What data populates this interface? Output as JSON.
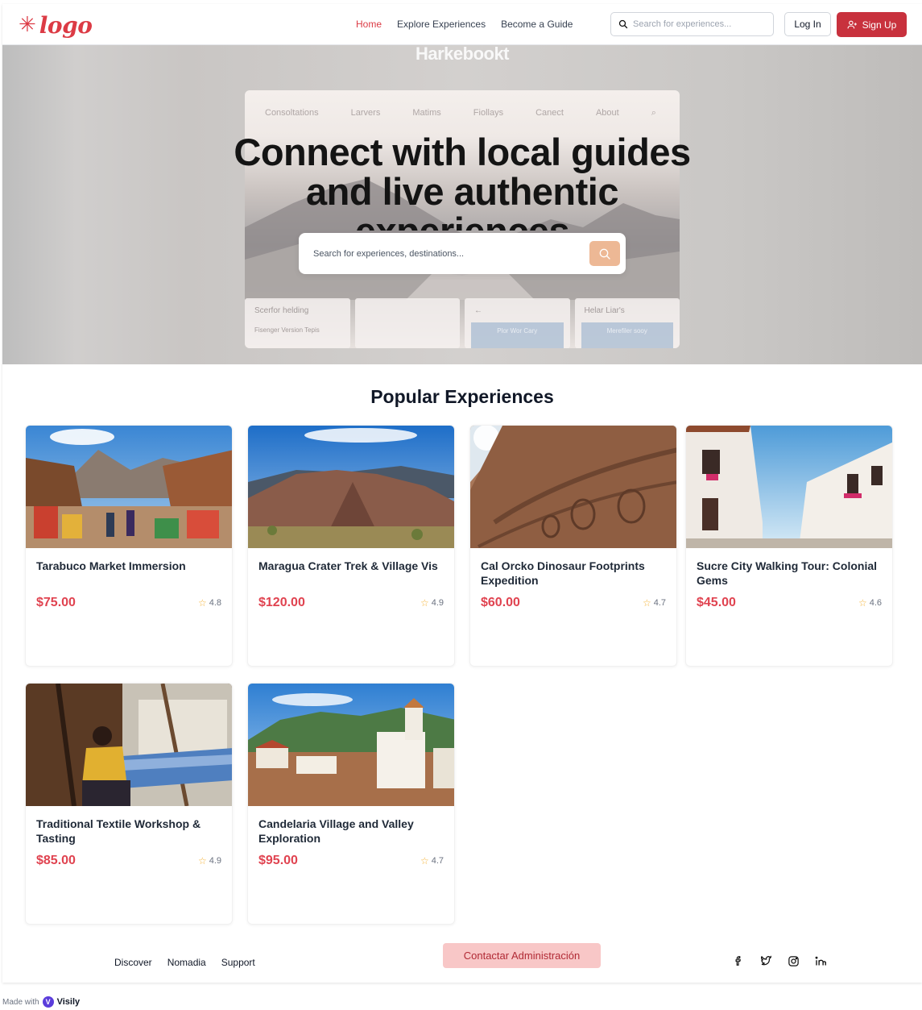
{
  "header": {
    "logo_text": "logo",
    "nav": [
      {
        "label": "Home",
        "active": true
      },
      {
        "label": "Explore Experiences",
        "active": false
      },
      {
        "label": "Become a Guide",
        "active": false
      }
    ],
    "search_placeholder": "Search for experiences...",
    "login_label": "Log In",
    "signup_label": "Sign Up"
  },
  "hero": {
    "ghost_title": "Harkebookt",
    "ghost_nav": [
      "Consoltations",
      "Larvers",
      "Matims",
      "Fiollays",
      "Canect",
      "About"
    ],
    "ghost_tiles": [
      {
        "title": "Scerfor helding",
        "sub": "Fisenger Version Tepis"
      },
      {
        "title": "",
        "sub": ""
      },
      {
        "title": "←",
        "sub": "Plor Wor Cary"
      },
      {
        "title": "Helar Liar's",
        "sub": "Merefiler sooy"
      }
    ],
    "headline_line1": "Connect with local guides",
    "headline_line2": "and live authentic",
    "headline_line3": "experiences",
    "search_placeholder": "Search for experiences, destinations..."
  },
  "section": {
    "title": "Popular Experiences"
  },
  "experiences": [
    {
      "title": "Tarabuco Market Immersion",
      "price": "$75.00",
      "rating": "4.8"
    },
    {
      "title": "Maragua Crater Trek & Village Vis",
      "price": "$120.00",
      "rating": "4.9"
    },
    {
      "title": "Cal Orcko Dinosaur Footprints Expedition",
      "price": "$60.00",
      "rating": "4.7"
    },
    {
      "title": "Sucre City Walking Tour: Colonial Gems",
      "price": "$45.00",
      "rating": "4.6"
    },
    {
      "title": "Traditional Textile Workshop & Tasting",
      "price": "$85.00",
      "rating": "4.9"
    },
    {
      "title": "Candelaria Village and Valley Exploration",
      "price": "$95.00",
      "rating": "4.7"
    }
  ],
  "footer": {
    "links": [
      "Discover",
      "Nomadia",
      "Support"
    ],
    "admin_label": "Contactar Administración",
    "socials": [
      "facebook-icon",
      "twitter-icon",
      "instagram-icon",
      "linkedin-icon"
    ]
  },
  "made_with": {
    "prefix": "Made with",
    "brand": "Visily"
  },
  "colors": {
    "accent": "#dc3b45",
    "signup": "#c8313d",
    "price": "#e04350",
    "star": "#f5b43b",
    "admin_bg": "#f8c7c7",
    "search_btn": "#edb895"
  }
}
